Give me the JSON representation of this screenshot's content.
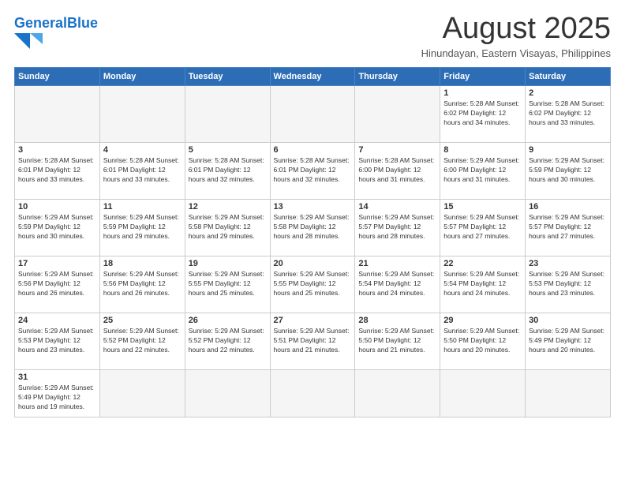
{
  "header": {
    "logo_general": "General",
    "logo_blue": "Blue",
    "title": "August 2025",
    "subtitle": "Hinundayan, Eastern Visayas, Philippines"
  },
  "days_of_week": [
    "Sunday",
    "Monday",
    "Tuesday",
    "Wednesday",
    "Thursday",
    "Friday",
    "Saturday"
  ],
  "weeks": [
    [
      {
        "day": "",
        "info": "",
        "empty": true
      },
      {
        "day": "",
        "info": "",
        "empty": true
      },
      {
        "day": "",
        "info": "",
        "empty": true
      },
      {
        "day": "",
        "info": "",
        "empty": true
      },
      {
        "day": "",
        "info": "",
        "empty": true
      },
      {
        "day": "1",
        "info": "Sunrise: 5:28 AM\nSunset: 6:02 PM\nDaylight: 12 hours\nand 34 minutes."
      },
      {
        "day": "2",
        "info": "Sunrise: 5:28 AM\nSunset: 6:02 PM\nDaylight: 12 hours\nand 33 minutes."
      }
    ],
    [
      {
        "day": "3",
        "info": "Sunrise: 5:28 AM\nSunset: 6:01 PM\nDaylight: 12 hours\nand 33 minutes."
      },
      {
        "day": "4",
        "info": "Sunrise: 5:28 AM\nSunset: 6:01 PM\nDaylight: 12 hours\nand 33 minutes."
      },
      {
        "day": "5",
        "info": "Sunrise: 5:28 AM\nSunset: 6:01 PM\nDaylight: 12 hours\nand 32 minutes."
      },
      {
        "day": "6",
        "info": "Sunrise: 5:28 AM\nSunset: 6:01 PM\nDaylight: 12 hours\nand 32 minutes."
      },
      {
        "day": "7",
        "info": "Sunrise: 5:28 AM\nSunset: 6:00 PM\nDaylight: 12 hours\nand 31 minutes."
      },
      {
        "day": "8",
        "info": "Sunrise: 5:29 AM\nSunset: 6:00 PM\nDaylight: 12 hours\nand 31 minutes."
      },
      {
        "day": "9",
        "info": "Sunrise: 5:29 AM\nSunset: 5:59 PM\nDaylight: 12 hours\nand 30 minutes."
      }
    ],
    [
      {
        "day": "10",
        "info": "Sunrise: 5:29 AM\nSunset: 5:59 PM\nDaylight: 12 hours\nand 30 minutes."
      },
      {
        "day": "11",
        "info": "Sunrise: 5:29 AM\nSunset: 5:59 PM\nDaylight: 12 hours\nand 29 minutes."
      },
      {
        "day": "12",
        "info": "Sunrise: 5:29 AM\nSunset: 5:58 PM\nDaylight: 12 hours\nand 29 minutes."
      },
      {
        "day": "13",
        "info": "Sunrise: 5:29 AM\nSunset: 5:58 PM\nDaylight: 12 hours\nand 28 minutes."
      },
      {
        "day": "14",
        "info": "Sunrise: 5:29 AM\nSunset: 5:57 PM\nDaylight: 12 hours\nand 28 minutes."
      },
      {
        "day": "15",
        "info": "Sunrise: 5:29 AM\nSunset: 5:57 PM\nDaylight: 12 hours\nand 27 minutes."
      },
      {
        "day": "16",
        "info": "Sunrise: 5:29 AM\nSunset: 5:57 PM\nDaylight: 12 hours\nand 27 minutes."
      }
    ],
    [
      {
        "day": "17",
        "info": "Sunrise: 5:29 AM\nSunset: 5:56 PM\nDaylight: 12 hours\nand 26 minutes."
      },
      {
        "day": "18",
        "info": "Sunrise: 5:29 AM\nSunset: 5:56 PM\nDaylight: 12 hours\nand 26 minutes."
      },
      {
        "day": "19",
        "info": "Sunrise: 5:29 AM\nSunset: 5:55 PM\nDaylight: 12 hours\nand 25 minutes."
      },
      {
        "day": "20",
        "info": "Sunrise: 5:29 AM\nSunset: 5:55 PM\nDaylight: 12 hours\nand 25 minutes."
      },
      {
        "day": "21",
        "info": "Sunrise: 5:29 AM\nSunset: 5:54 PM\nDaylight: 12 hours\nand 24 minutes."
      },
      {
        "day": "22",
        "info": "Sunrise: 5:29 AM\nSunset: 5:54 PM\nDaylight: 12 hours\nand 24 minutes."
      },
      {
        "day": "23",
        "info": "Sunrise: 5:29 AM\nSunset: 5:53 PM\nDaylight: 12 hours\nand 23 minutes."
      }
    ],
    [
      {
        "day": "24",
        "info": "Sunrise: 5:29 AM\nSunset: 5:53 PM\nDaylight: 12 hours\nand 23 minutes."
      },
      {
        "day": "25",
        "info": "Sunrise: 5:29 AM\nSunset: 5:52 PM\nDaylight: 12 hours\nand 22 minutes."
      },
      {
        "day": "26",
        "info": "Sunrise: 5:29 AM\nSunset: 5:52 PM\nDaylight: 12 hours\nand 22 minutes."
      },
      {
        "day": "27",
        "info": "Sunrise: 5:29 AM\nSunset: 5:51 PM\nDaylight: 12 hours\nand 21 minutes."
      },
      {
        "day": "28",
        "info": "Sunrise: 5:29 AM\nSunset: 5:50 PM\nDaylight: 12 hours\nand 21 minutes."
      },
      {
        "day": "29",
        "info": "Sunrise: 5:29 AM\nSunset: 5:50 PM\nDaylight: 12 hours\nand 20 minutes."
      },
      {
        "day": "30",
        "info": "Sunrise: 5:29 AM\nSunset: 5:49 PM\nDaylight: 12 hours\nand 20 minutes."
      }
    ],
    [
      {
        "day": "31",
        "info": "Sunrise: 5:29 AM\nSunset: 5:49 PM\nDaylight: 12 hours\nand 19 minutes.",
        "last": true
      },
      {
        "day": "",
        "info": "",
        "empty": true,
        "last": true
      },
      {
        "day": "",
        "info": "",
        "empty": true,
        "last": true
      },
      {
        "day": "",
        "info": "",
        "empty": true,
        "last": true
      },
      {
        "day": "",
        "info": "",
        "empty": true,
        "last": true
      },
      {
        "day": "",
        "info": "",
        "empty": true,
        "last": true
      },
      {
        "day": "",
        "info": "",
        "empty": true,
        "last": true
      }
    ]
  ]
}
